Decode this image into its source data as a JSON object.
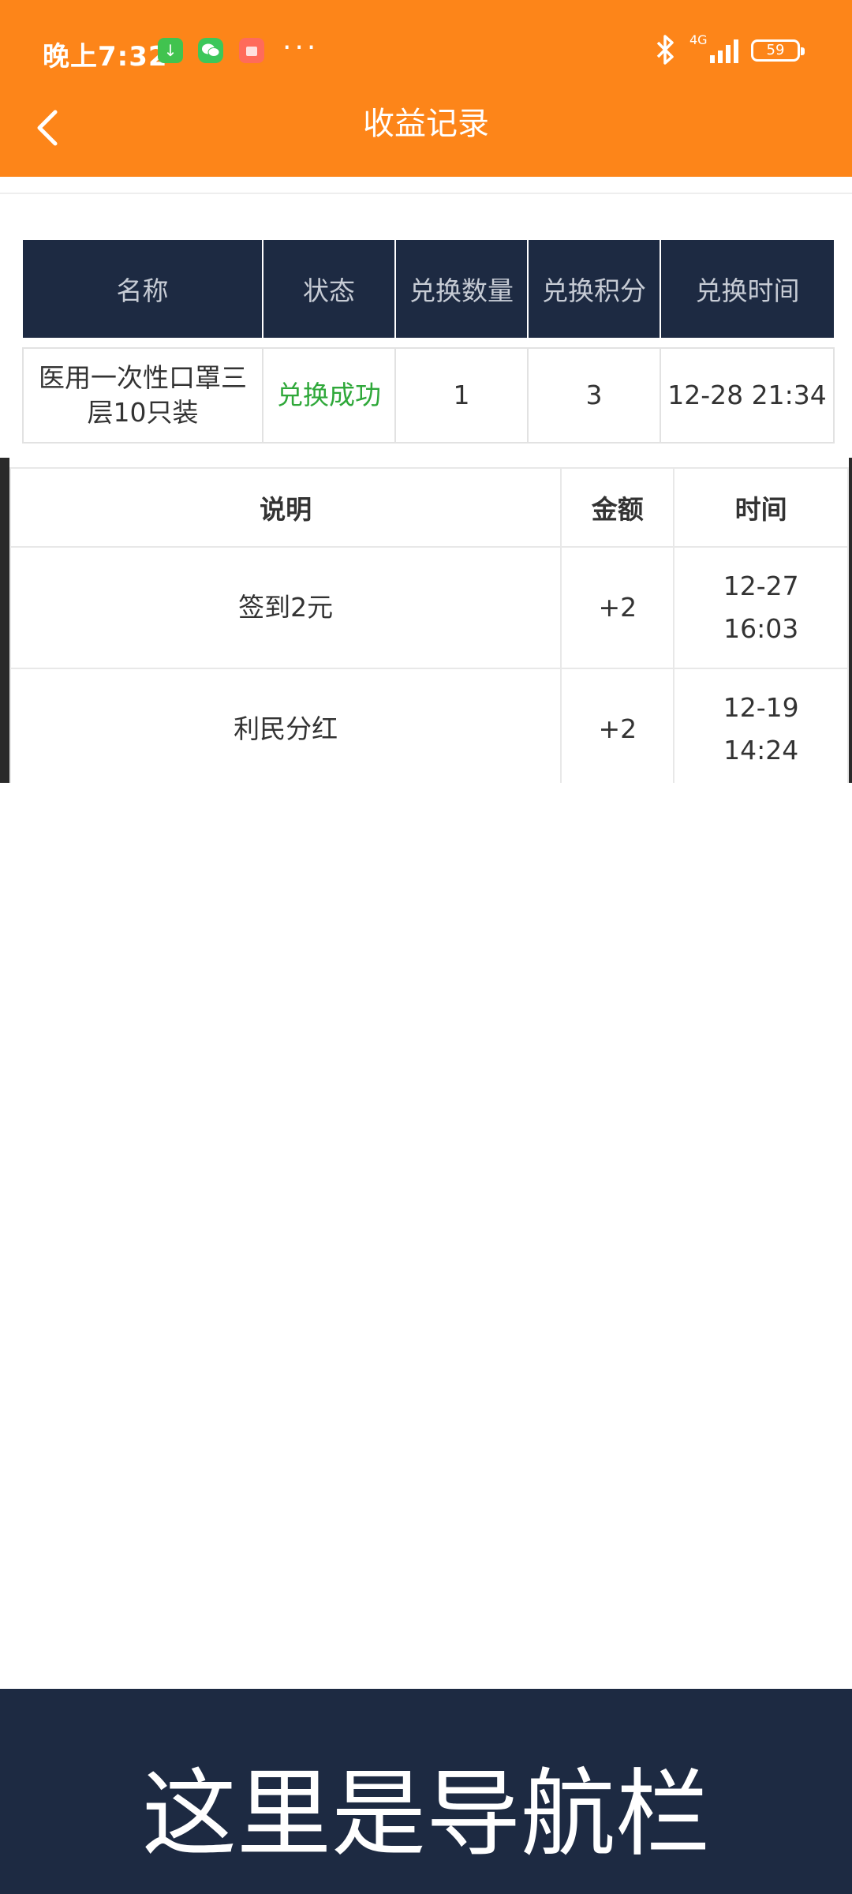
{
  "status_bar": {
    "time": "晚上7:32",
    "network": "4G",
    "battery": "59",
    "more": "···"
  },
  "header": {
    "title": "收益记录"
  },
  "exchange_table": {
    "columns": [
      "名称",
      "状态",
      "兑换数量",
      "兑换积分",
      "兑换时间"
    ],
    "rows": [
      {
        "name": "医用一次性口罩三层10只装",
        "status": "兑换成功",
        "quantity": "1",
        "points": "3",
        "time": "12-28 21:34"
      }
    ]
  },
  "earnings_table": {
    "columns": [
      "说明",
      "金额",
      "时间"
    ],
    "rows": [
      {
        "desc": "签到2元",
        "amount": "+2",
        "time": "12-27\n16:03"
      },
      {
        "desc": "利民分红",
        "amount": "+2",
        "time": "12-19\n14:24"
      }
    ]
  },
  "bottom_nav": {
    "label": "这里是导航栏"
  },
  "colors": {
    "header_bg": "#fd8519",
    "table_header_bg": "#1d2a42",
    "success_green": "#2fa83a",
    "nav_bg": "#1d2a42"
  }
}
